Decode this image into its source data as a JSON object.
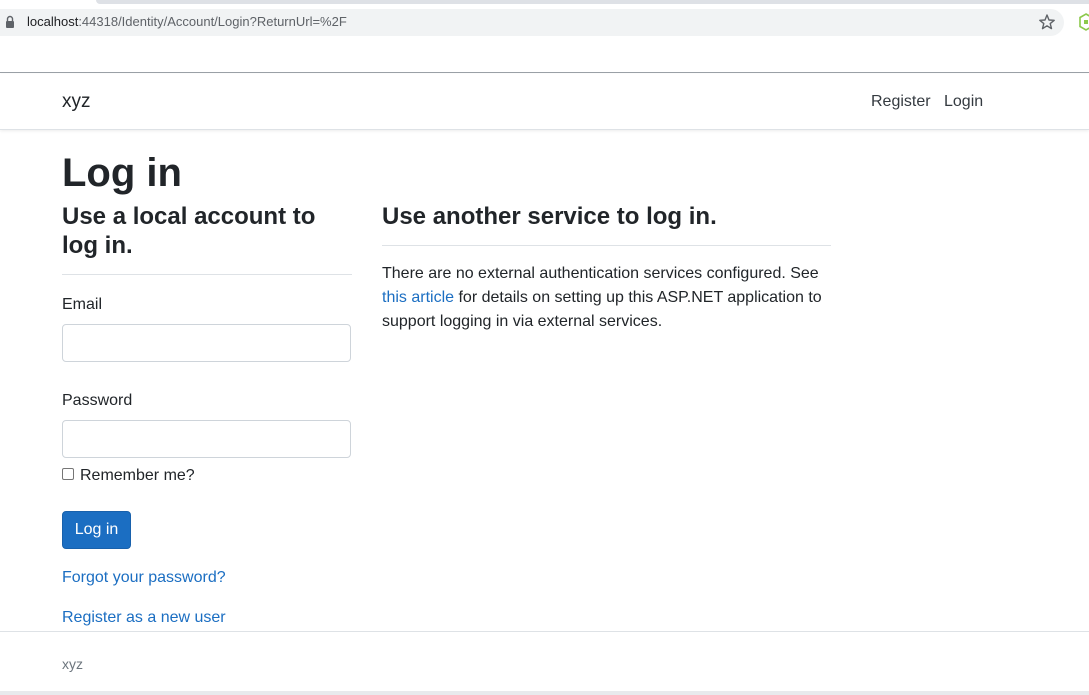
{
  "browser": {
    "url_host": "localhost",
    "url_path": ":44318/Identity/Account/Login?ReturnUrl=%2F",
    "icons": {
      "lock": "lock-icon",
      "bookmark": "star-icon",
      "extension": "extension-icon"
    }
  },
  "navbar": {
    "brand": "xyz",
    "links": [
      "Register",
      "Login"
    ]
  },
  "main": {
    "title": "Log in",
    "local": {
      "heading": "Use a local account to log in.",
      "email_label": "Email",
      "email_value": "",
      "password_label": "Password",
      "password_value": "",
      "remember_label": "Remember me?",
      "remember_checked": false,
      "submit_label": "Log in",
      "forgot_link": "Forgot your password?",
      "register_link": "Register as a new user"
    },
    "external": {
      "heading": "Use another service to log in.",
      "text_before": "There are no external authentication services configured. See ",
      "link_text": "this article",
      "text_after": " for details on setting up this ASP.NET application to support logging in via external services."
    }
  },
  "footer": {
    "text": "xyz"
  },
  "colors": {
    "primary": "#1b6ec2",
    "text": "#212529",
    "border": "#dee2e6"
  }
}
